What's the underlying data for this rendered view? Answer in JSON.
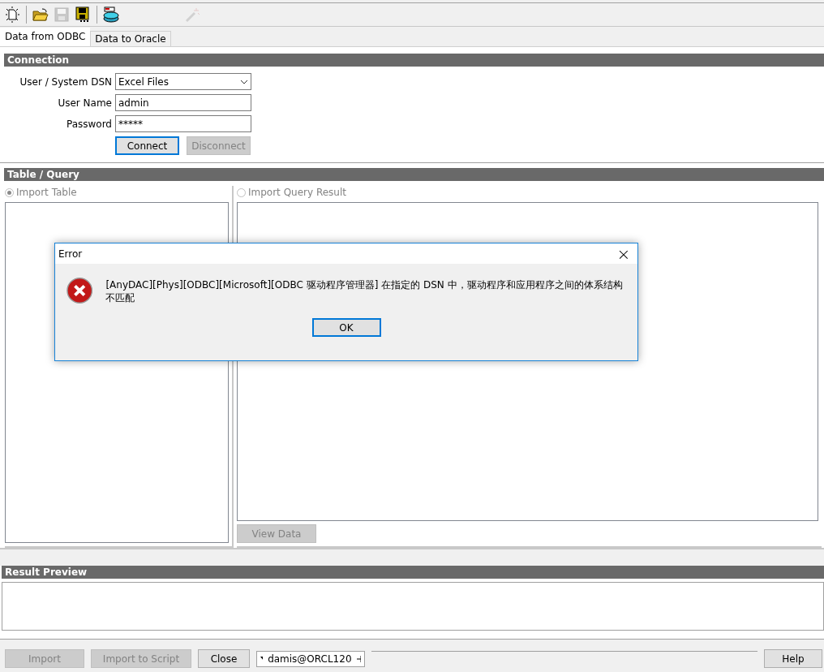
{
  "toolbar": [
    {
      "kind": "new",
      "disabled": false
    },
    {
      "kind": "separator"
    },
    {
      "kind": "open",
      "disabled": false
    },
    {
      "kind": "save",
      "disabled": true
    },
    {
      "kind": "save-all",
      "disabled": false
    },
    {
      "kind": "separator"
    },
    {
      "kind": "database",
      "disabled": false
    },
    {
      "kind": "spacer"
    },
    {
      "kind": "wand",
      "disabled": true
    }
  ],
  "tabs": [
    {
      "label": "Data from ODBC",
      "selected": true
    },
    {
      "label": "Data to Oracle",
      "selected": false
    }
  ],
  "connection": {
    "title": "Connection",
    "fields": [
      {
        "kind": "dropdown",
        "label": "User / System DSN",
        "value": "Excel Files"
      },
      {
        "kind": "text",
        "label": "User Name",
        "value": "admin"
      },
      {
        "kind": "text",
        "label": "Password",
        "value": "*****"
      }
    ],
    "buttons": [
      {
        "label": "Connect",
        "disabled": false,
        "focused": true
      },
      {
        "label": "Disconnect",
        "disabled": true,
        "focused": false
      }
    ]
  },
  "table_query": {
    "title": "Table / Query",
    "options": [
      {
        "label": "Import Table",
        "selected": true,
        "disabled": true
      },
      {
        "label": "Import Query Result",
        "selected": false,
        "disabled": true
      }
    ],
    "view_button": {
      "label": "View Data",
      "disabled": true
    }
  },
  "result_preview": {
    "title": "Result Preview"
  },
  "bottom_buttons": [
    {
      "label": "Import",
      "disabled": true
    },
    {
      "label": "Import to Script",
      "disabled": true
    },
    {
      "label": "Close",
      "disabled": false
    }
  ],
  "connection_selector": {
    "value": "damis@ORCL120"
  },
  "help_button": {
    "label": "Help"
  },
  "dialog": {
    "title": "Error",
    "close": "×",
    "message": "[AnyDAC][Phys][ODBC][Microsoft][ODBC 驱动程序管理器] 在指定的 DSN 中，驱动程序和应用程序之间的体系结构不匹配",
    "button": "OK"
  }
}
